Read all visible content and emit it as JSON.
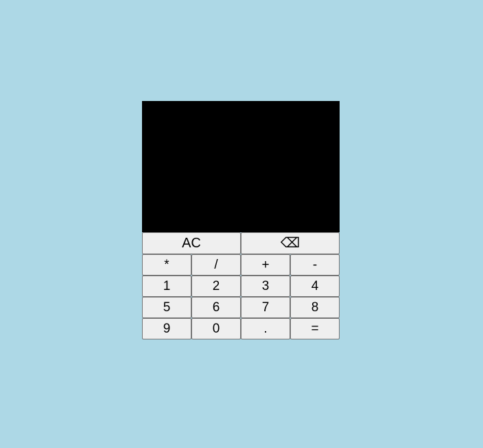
{
  "display": {
    "value": ""
  },
  "top_row": [
    {
      "label": "AC",
      "name": "clear-button"
    },
    {
      "label": "⌫",
      "name": "backspace-button"
    }
  ],
  "operator_row": [
    {
      "label": "*",
      "name": "multiply-button"
    },
    {
      "label": "/",
      "name": "divide-button"
    },
    {
      "label": "+",
      "name": "add-button"
    },
    {
      "label": "-",
      "name": "subtract-button"
    }
  ],
  "digits_row_1": [
    {
      "label": "1",
      "name": "digit-1-button"
    },
    {
      "label": "2",
      "name": "digit-2-button"
    },
    {
      "label": "3",
      "name": "digit-3-button"
    },
    {
      "label": "4",
      "name": "digit-4-button"
    }
  ],
  "digits_row_2": [
    {
      "label": "5",
      "name": "digit-5-button"
    },
    {
      "label": "6",
      "name": "digit-6-button"
    },
    {
      "label": "7",
      "name": "digit-7-button"
    },
    {
      "label": "8",
      "name": "digit-8-button"
    }
  ],
  "digits_row_3": [
    {
      "label": "9",
      "name": "digit-9-button"
    },
    {
      "label": "0",
      "name": "digit-0-button"
    },
    {
      "label": ".",
      "name": "decimal-button"
    },
    {
      "label": "=",
      "name": "equals-button"
    }
  ],
  "colors": {
    "page_background": "#add8e6",
    "display_background": "#000000",
    "button_background": "#efefef",
    "button_border": "#767676"
  }
}
